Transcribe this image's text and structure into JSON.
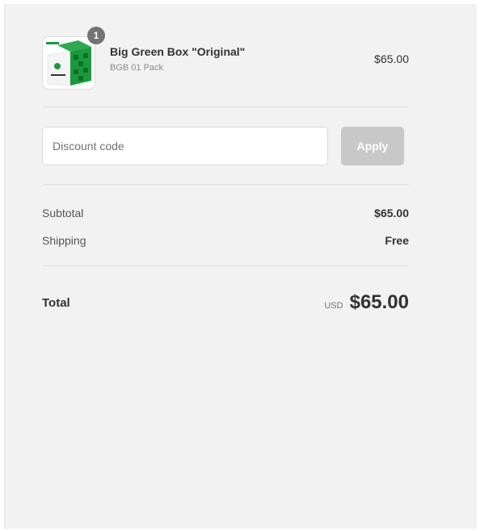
{
  "cart": {
    "item": {
      "quantity": "1",
      "name": "Big Green Box \"Original\"",
      "variant": "BGB 01 Pack",
      "price": "$65.00"
    }
  },
  "discount": {
    "placeholder": "Discount code",
    "apply_label": "Apply"
  },
  "summary": {
    "subtotal_label": "Subtotal",
    "subtotal_value": "$65.00",
    "shipping_label": "Shipping",
    "shipping_value": "Free",
    "total_label": "Total",
    "currency": "USD",
    "total_value": "$65.00"
  },
  "colors": {
    "panel_bg": "#f2f2f2",
    "badge": "#737373",
    "apply_disabled": "#c8c8c8",
    "box_green": "#1a9a3c"
  },
  "icons": {
    "product_image": "green-box-product-image"
  }
}
